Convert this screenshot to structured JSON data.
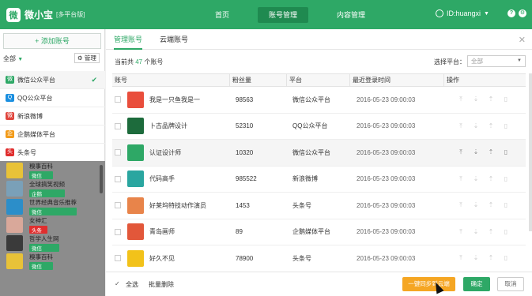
{
  "app": {
    "name": "微小宝",
    "subtitle": "[多平台版]",
    "logo_icon": "logo-icon"
  },
  "nav": [
    {
      "label": "首页",
      "active": false
    },
    {
      "label": "账号管理",
      "active": true
    },
    {
      "label": "内容管理",
      "active": false
    }
  ],
  "user": {
    "label": "ID:huangxi",
    "icon": "user-icon"
  },
  "topIcons": [
    "help-icon",
    "settings-icon"
  ],
  "left": {
    "add_button": "添加账号",
    "filter": "全部",
    "manage_button": "管理",
    "platforms": [
      {
        "label": "微信公众平台",
        "color": "#2ea866",
        "icon": "wechat-icon",
        "active": true
      },
      {
        "label": "QQ公众平台",
        "color": "#1a8fe0",
        "icon": "qq-icon",
        "active": false
      },
      {
        "label": "新浪微博",
        "color": "#e0463e",
        "icon": "weibo-icon",
        "active": false
      },
      {
        "label": "企鹅媒体平台",
        "color": "#f29b1a",
        "icon": "penguin-icon",
        "active": false
      },
      {
        "label": "头条号",
        "color": "#e02e2e",
        "icon": "toutiao-icon",
        "active": false
      }
    ],
    "accounts": [
      {
        "name": "糗事百科",
        "tag": "微信",
        "tag_color": "#2ea866",
        "avatar_color": "#e8c238"
      },
      {
        "name": "全球搞笑视频",
        "tag": "企鹅",
        "tag_color": "#2ea866",
        "avatar_color": "#7aa0b8"
      },
      {
        "name": "世界经典音乐推荐",
        "tag": "微信",
        "tag_color": "#2ea866",
        "avatar_color": "#2c8ec9"
      },
      {
        "name": "女神汇",
        "tag": "头条",
        "tag_color": "#e02e2e",
        "avatar_color": "#d9a89a"
      },
      {
        "name": "哲学人生网",
        "tag": "微信",
        "tag_color": "#2ea866",
        "avatar_color": "#3a3a3a"
      },
      {
        "name": "糗事百科",
        "tag": "微信",
        "tag_color": "#2ea866",
        "avatar_color": "#e8c238"
      }
    ]
  },
  "main": {
    "tabs": [
      {
        "label": "管理账号",
        "active": true
      },
      {
        "label": "云端账号",
        "active": false
      }
    ],
    "close_icon": "close-icon",
    "summary_prefix": "当前共",
    "summary_count": "47",
    "summary_suffix": "个账号",
    "select_label": "选择平台：",
    "select_value": "全部",
    "columns": [
      "账号",
      "粉丝量",
      "平台",
      "最近登录时间",
      "操作"
    ],
    "rows": [
      {
        "name": "我是一只鱼我是一",
        "fans": "98563",
        "platform": "微信公众平台",
        "time": "2016-05-23 09:00:03",
        "avatar_color": "#e94e3c",
        "hover": false
      },
      {
        "name": "卜古品牌设计",
        "fans": "52310",
        "platform": "QQ公众平台",
        "time": "2016-05-23 09:00:03",
        "avatar_color": "#1d6b3c",
        "hover": false
      },
      {
        "name": "认证设计师",
        "fans": "10320",
        "platform": "微信公众平台",
        "time": "2016-05-23 09:00:03",
        "avatar_color": "#2ea866",
        "hover": true
      },
      {
        "name": "代码高手",
        "fans": "985522",
        "platform": "新浪微博",
        "time": "2016-05-23 09:00:03",
        "avatar_color": "#2aa6a0",
        "hover": false
      },
      {
        "name": "好莱坞特技动作演员",
        "fans": "1453",
        "platform": "头条号",
        "time": "2016-05-23 09:00:03",
        "avatar_color": "#e8844a",
        "hover": false
      },
      {
        "name": "青岛画师",
        "fans": "89",
        "platform": "企鹅媒体平台",
        "time": "2016-05-23 09:00:03",
        "avatar_color": "#e2573a",
        "hover": false
      },
      {
        "name": "好久不见",
        "fans": "78900",
        "platform": "头条号",
        "time": "2016-05-23 09:00:03",
        "avatar_color": "#f2c21a",
        "hover": false
      }
    ],
    "op_icons": [
      "pin-top-icon",
      "move-down-icon",
      "move-up-icon",
      "delete-icon"
    ]
  },
  "footer": {
    "select_all": "全选",
    "batch_delete": "批量删除",
    "sync_button": "一键同步到云端",
    "ok_button": "确定",
    "cancel_button": "取消"
  }
}
